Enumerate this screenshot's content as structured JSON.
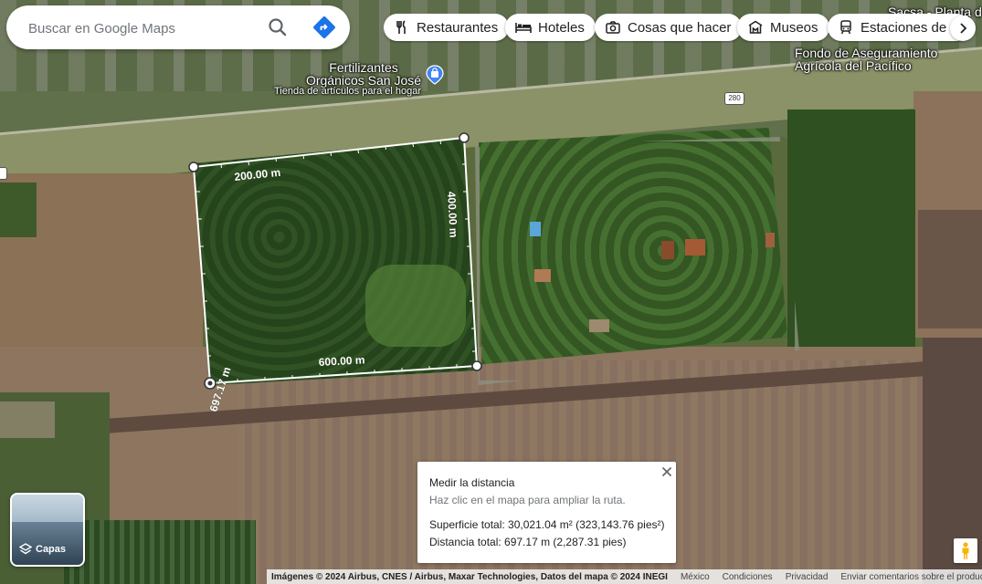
{
  "search": {
    "placeholder": "Buscar en Google Maps"
  },
  "chips": [
    {
      "label": "Restaurantes",
      "icon": "fork-knife-icon"
    },
    {
      "label": "Hoteles",
      "icon": "bed-icon"
    },
    {
      "label": "Cosas que hacer",
      "icon": "camera-icon"
    },
    {
      "label": "Museos",
      "icon": "museum-icon"
    },
    {
      "label": "Estaciones de tr",
      "icon": "transit-icon"
    }
  ],
  "map_labels": {
    "poi_name_line1": "Fertilizantes",
    "poi_name_line2": "Orgánicos San José",
    "poi_category": "Tienda de artículos para el hogar",
    "fondo_line1": "Fondo de Aseguramiento",
    "fondo_line2": "Agrícola del Pacífico",
    "sacsa": "Sacsa - Planta d",
    "route_number": "280"
  },
  "measurements": {
    "top": "200.00 m",
    "right": "400.00 m",
    "bottom": "600.00 m",
    "left": "697.17 m"
  },
  "card": {
    "title": "Medir la distancia",
    "hint": "Haz clic en el mapa para ampliar la ruta.",
    "area": "Superficie total: 30,021.04 m² (323,143.76 pies²)",
    "distance": "Distancia total: 697.17 m (2,287.31 pies)"
  },
  "layers": {
    "label": "Capas"
  },
  "footer": {
    "attribution": "Imágenes © 2024 Airbus, CNES / Airbus, Maxar Technologies, Datos del mapa © 2024 INEGI",
    "links": [
      "México",
      "Condiciones",
      "Privacidad",
      "Enviar comentarios sobre el producto"
    ]
  }
}
